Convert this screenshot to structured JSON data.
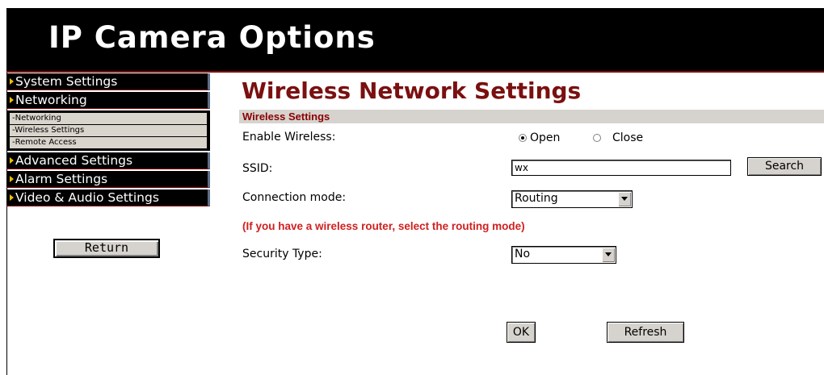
{
  "header": {
    "title": "IP Camera Options"
  },
  "sidebar": {
    "items": [
      {
        "label": "System Settings",
        "icon": "arrow-right-icon"
      },
      {
        "label": "Networking",
        "icon": "arrow-right-icon"
      },
      {
        "label": "Advanced Settings",
        "icon": "arrow-right-icon"
      },
      {
        "label": "Alarm Settings",
        "icon": "arrow-right-icon"
      },
      {
        "label": "Video & Audio Settings",
        "icon": "arrow-right-icon"
      }
    ],
    "subitems": [
      "-Networking",
      "-Wireless Settings",
      "-Remote Access"
    ],
    "return_label": "Return"
  },
  "main": {
    "title": "Wireless Network Settings",
    "section": "Wireless Settings",
    "enable_wireless": {
      "label": "Enable Wireless:",
      "options": [
        "Open",
        "Close"
      ],
      "selected": "Open"
    },
    "ssid": {
      "label": "SSID:",
      "value": "wx",
      "search_label": "Search"
    },
    "connection_mode": {
      "label": "Connection mode:",
      "value": "Routing"
    },
    "note": "(If you have a wireless router, select the routing mode)",
    "security_type": {
      "label": "Security Type:",
      "value": "No"
    },
    "ok_label": "OK",
    "refresh_label": "Refresh"
  },
  "colors": {
    "accent": "#7a1010",
    "note": "#d02020",
    "header_bg": "#000000"
  }
}
